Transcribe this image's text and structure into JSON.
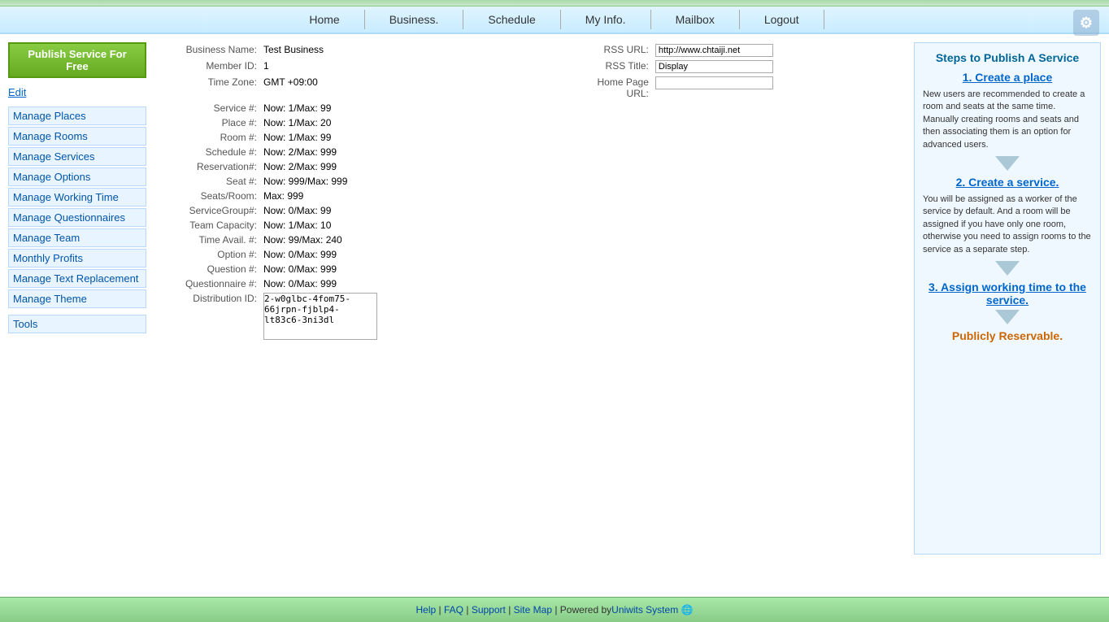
{
  "topbar": {},
  "nav": {
    "home": "Home",
    "business": "Business.",
    "schedule": "Schedule",
    "myinfo": "My Info.",
    "mailbox": "Mailbox",
    "logout": "Logout"
  },
  "sidebar": {
    "publish_btn": "Publish Service For Free",
    "edit_link": "Edit",
    "links": [
      {
        "label": "Manage Places",
        "name": "manage-places"
      },
      {
        "label": "Manage Rooms",
        "name": "manage-rooms"
      },
      {
        "label": "Manage Services",
        "name": "manage-services"
      },
      {
        "label": "Manage Options",
        "name": "manage-options"
      },
      {
        "label": "Manage Working Time",
        "name": "manage-working-time"
      },
      {
        "label": "Manage Questionnaires",
        "name": "manage-questionnaires"
      },
      {
        "label": "Manage Team",
        "name": "manage-team"
      },
      {
        "label": "Monthly Profits",
        "name": "monthly-profits"
      },
      {
        "label": "Manage Text Replacement",
        "name": "manage-text-replacement"
      },
      {
        "label": "Manage Theme",
        "name": "manage-theme"
      }
    ],
    "tools_label": "Tools"
  },
  "business_info": {
    "fields": [
      {
        "label": "Business Name:",
        "value": "Test Business"
      },
      {
        "label": "Member ID:",
        "value": "1"
      },
      {
        "label": "Time Zone:",
        "value": "GMT +09:00"
      },
      {
        "label": "Service #:",
        "value": "Now: 1/Max: 99"
      },
      {
        "label": "Place #:",
        "value": "Now: 1/Max: 20"
      },
      {
        "label": "Room #:",
        "value": "Now: 1/Max: 99"
      },
      {
        "label": "Schedule #:",
        "value": "Now: 2/Max: 999"
      },
      {
        "label": "Reservation#:",
        "value": "Now: 2/Max: 999"
      },
      {
        "label": "Seat #:",
        "value": "Now: 999/Max: 999"
      },
      {
        "label": "Seats/Room:",
        "value": "Max: 999"
      },
      {
        "label": "ServiceGroup#:",
        "value": "Now: 0/Max: 99"
      },
      {
        "label": "Team Capacity:",
        "value": "Now: 1/Max: 10"
      },
      {
        "label": "Time Avail. #:",
        "value": "Now: 99/Max: 240"
      },
      {
        "label": "Option #:",
        "value": "Now: 0/Max: 999"
      },
      {
        "label": "Question #:",
        "value": "Now: 0/Max: 999"
      },
      {
        "label": "Questionnaire #:",
        "value": "Now: 0/Max: 999"
      },
      {
        "label": "Distribution ID:",
        "value": "2-w0glbc-4fom75-66jrpn-fjblp4-lt83c6-3ni3dl"
      }
    ]
  },
  "rss": {
    "rss_url_label": "RSS URL:",
    "rss_url_value": "http://www.chtaiji.net",
    "rss_title_label": "RSS Title:",
    "rss_title_value": "Display",
    "home_page_url_label": "Home Page URL:",
    "home_page_url_value": ""
  },
  "steps": {
    "title": "Steps to Publish A Service",
    "step1_link": "1. Create a place",
    "step1_desc": "New users are recommended to create a room and seats at the same time. Manually creating rooms and seats and then associating them is an option for advanced users.",
    "step2_link": "2. Create a service.",
    "step2_desc": "You will be assigned as a worker of the service by default. And a room will be assigned if you have only one room, otherwise you need to assign rooms to the service as a separate step.",
    "step3_link": "3. Assign working time to the service.",
    "publicly_reservable": "Publicly Reservable."
  },
  "footer": {
    "help": "Help",
    "faq": "FAQ",
    "support": "Support",
    "sitemap": "Site Map",
    "powered_by": "| Powered by",
    "uniwits": "Uniwits System"
  }
}
